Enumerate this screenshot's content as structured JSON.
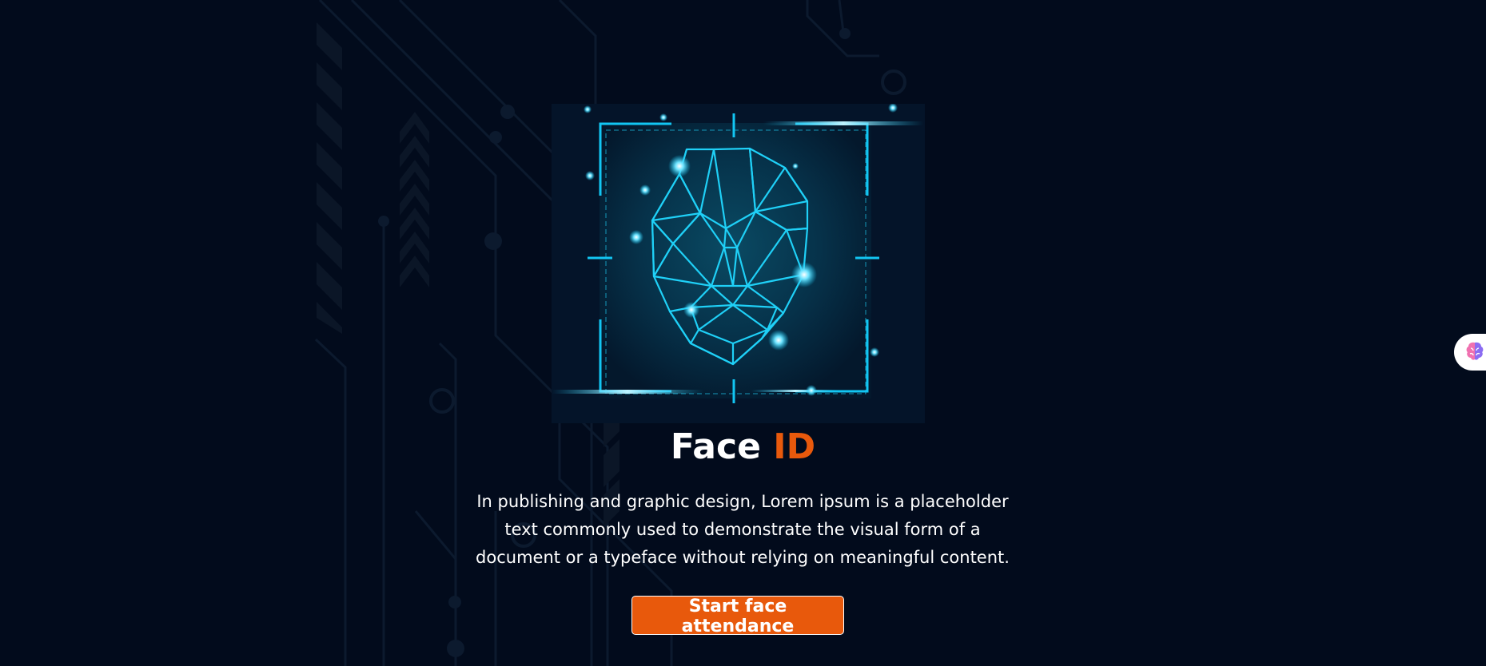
{
  "title": {
    "main": "Face",
    "accent": "ID"
  },
  "description": "In publishing and graphic design, Lorem ipsum is a placeholder text commonly used to demonstrate the visual form of a document or a typeface without relying on meaningful content.",
  "cta": {
    "label": "Start face attendance"
  },
  "floating_widget": {
    "icon": "brain-icon"
  },
  "hero_image": {
    "icon": "face-scan-icon"
  },
  "colors": {
    "background": "#020b1c",
    "accent": "#e8590c",
    "glow": "#12c6f3"
  }
}
